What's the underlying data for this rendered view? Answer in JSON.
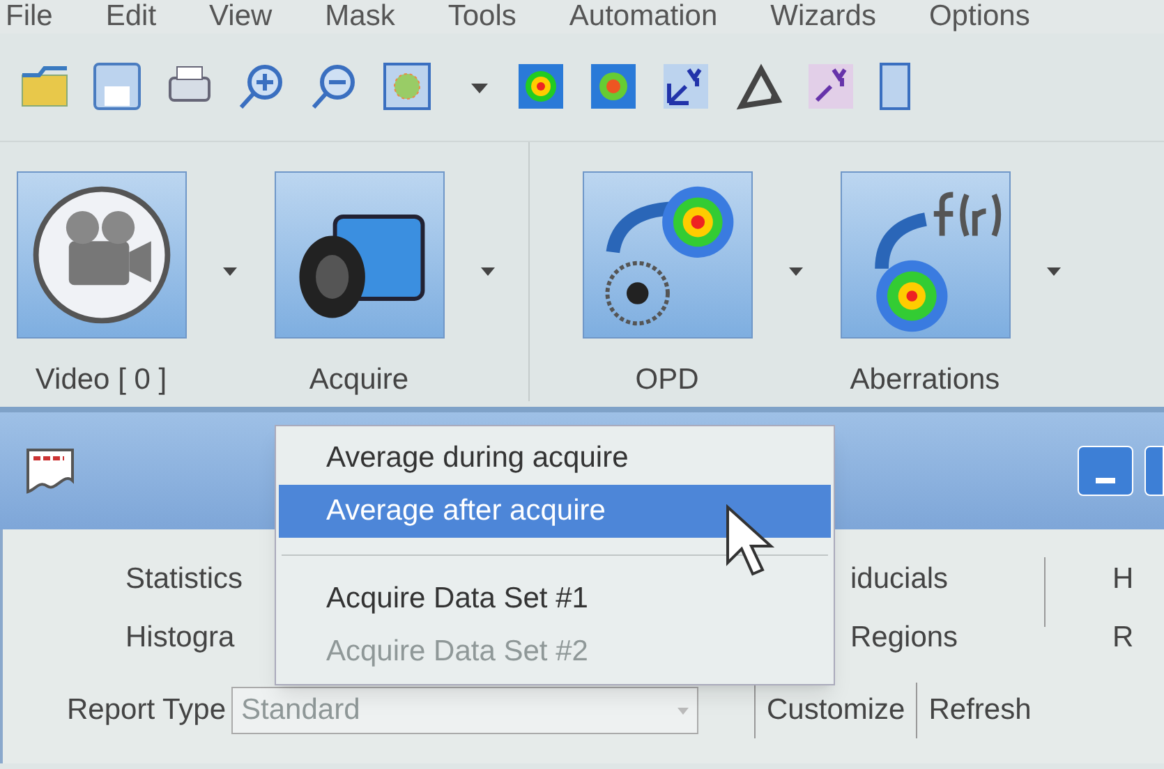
{
  "menu_bar": [
    "File",
    "Edit",
    "View",
    "Mask",
    "Tools",
    "Automation",
    "Wizards",
    "Options"
  ],
  "ribbon": [
    {
      "label": "Video [ 0 ]"
    },
    {
      "label": "Acquire"
    },
    {
      "label": "OPD"
    },
    {
      "label": "Aberrations"
    }
  ],
  "document_window": {
    "tab_columns": [
      [
        "Statistics",
        "Histogra"
      ],
      [
        "iducials",
        "Regions"
      ],
      [
        "H",
        "R"
      ]
    ],
    "report_type": {
      "label": "Report Type",
      "value": "Standard",
      "disabled": true
    },
    "buttons": [
      "Customize",
      "Refresh"
    ]
  },
  "popup_menu": [
    {
      "kind": "item",
      "label": "Average during acquire",
      "selected": false,
      "disabled": false
    },
    {
      "kind": "item",
      "label": "Average after acquire",
      "selected": true,
      "disabled": false
    },
    {
      "kind": "separator"
    },
    {
      "kind": "item",
      "label": "Acquire Data Set #1",
      "selected": false,
      "disabled": false
    },
    {
      "kind": "item",
      "label": "Acquire Data Set #2",
      "selected": false,
      "disabled": true
    }
  ]
}
